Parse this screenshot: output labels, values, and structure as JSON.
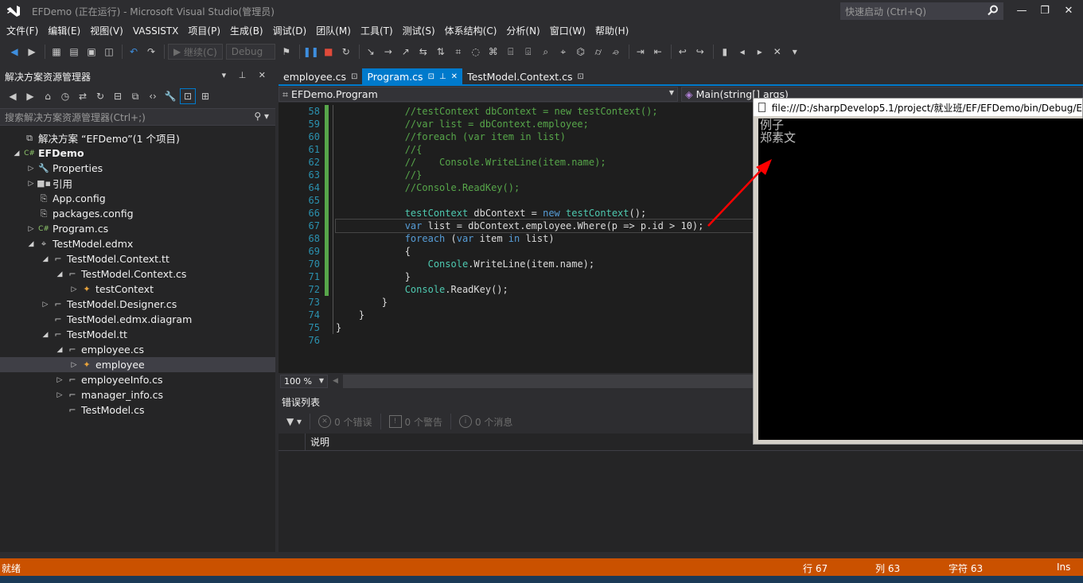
{
  "window": {
    "title": "EFDemo (正在运行) - Microsoft Visual Studio(管理员)",
    "quick_launch_placeholder": "快速启动 (Ctrl+Q)"
  },
  "menu": [
    "文件(F)",
    "编辑(E)",
    "视图(V)",
    "VASSISTX",
    "项目(P)",
    "生成(B)",
    "调试(D)",
    "团队(M)",
    "工具(T)",
    "测试(S)",
    "体系结构(C)",
    "分析(N)",
    "窗口(W)",
    "帮助(H)"
  ],
  "toolbar": {
    "continue_label": "继续(C)",
    "config_value": "Debug"
  },
  "solution_explorer": {
    "title": "解决方案资源管理器",
    "search_placeholder": "搜索解决方案资源管理器(Ctrl+;)",
    "tree": [
      {
        "label": "解决方案 “EFDemo”(1 个项目)",
        "indent": 0,
        "arrow": "",
        "icon": "solution-icon"
      },
      {
        "label": "EFDemo",
        "indent": 0,
        "arrow": "◢",
        "icon": "csharp-project-icon",
        "bold": true
      },
      {
        "label": "Properties",
        "indent": 1,
        "arrow": "▷",
        "icon": "wrench-icon"
      },
      {
        "label": "引用",
        "indent": 1,
        "arrow": "▷",
        "icon": "references-icon"
      },
      {
        "label": "App.config",
        "indent": 1,
        "arrow": "",
        "icon": "config-file-icon"
      },
      {
        "label": "packages.config",
        "indent": 1,
        "arrow": "",
        "icon": "config-file-icon"
      },
      {
        "label": "Program.cs",
        "indent": 1,
        "arrow": "▷",
        "icon": "csharp-file-icon"
      },
      {
        "label": "TestModel.edmx",
        "indent": 1,
        "arrow": "◢",
        "icon": "edmx-icon"
      },
      {
        "label": "TestModel.Context.tt",
        "indent": 2,
        "arrow": "◢",
        "icon": "tt-file-icon"
      },
      {
        "label": "TestModel.Context.cs",
        "indent": 3,
        "arrow": "◢",
        "icon": "cs-file-icon"
      },
      {
        "label": "testContext",
        "indent": 4,
        "arrow": "▷",
        "icon": "class-icon"
      },
      {
        "label": "TestModel.Designer.cs",
        "indent": 2,
        "arrow": "▷",
        "icon": "cs-file-icon"
      },
      {
        "label": "TestModel.edmx.diagram",
        "indent": 2,
        "arrow": "",
        "icon": "file-icon"
      },
      {
        "label": "TestModel.tt",
        "indent": 2,
        "arrow": "◢",
        "icon": "tt-file-icon"
      },
      {
        "label": "employee.cs",
        "indent": 3,
        "arrow": "◢",
        "icon": "cs-file-icon"
      },
      {
        "label": "employee",
        "indent": 4,
        "arrow": "▷",
        "icon": "class-icon",
        "selected": true
      },
      {
        "label": "employeeInfo.cs",
        "indent": 3,
        "arrow": "▷",
        "icon": "cs-file-icon"
      },
      {
        "label": "manager_info.cs",
        "indent": 3,
        "arrow": "▷",
        "icon": "cs-file-icon"
      },
      {
        "label": "TestModel.cs",
        "indent": 3,
        "arrow": "",
        "icon": "cs-file-icon"
      }
    ]
  },
  "tabs": [
    {
      "label": "employee.cs",
      "active": false
    },
    {
      "label": "Program.cs",
      "active": true
    },
    {
      "label": "TestModel.Context.cs",
      "active": false
    }
  ],
  "navbar": {
    "type_scope": "EFDemo.Program",
    "member_scope": "Main(string[] args)"
  },
  "editor": {
    "lines": [
      {
        "n": "58",
        "segs": [
          [
            "c-com",
            "            //testContext dbContext = new testContext();"
          ]
        ]
      },
      {
        "n": "59",
        "segs": [
          [
            "c-com",
            "            //var list = dbContext.employee;"
          ]
        ]
      },
      {
        "n": "60",
        "segs": [
          [
            "c-com",
            "            //foreach (var item in list)"
          ]
        ]
      },
      {
        "n": "61",
        "segs": [
          [
            "c-com",
            "            //{"
          ]
        ]
      },
      {
        "n": "62",
        "segs": [
          [
            "c-com",
            "            //    Console.WriteLine(item.name);"
          ]
        ]
      },
      {
        "n": "63",
        "segs": [
          [
            "c-com",
            "            //}"
          ]
        ]
      },
      {
        "n": "64",
        "segs": [
          [
            "c-com",
            "            //Console.ReadKey();"
          ]
        ]
      },
      {
        "n": "65",
        "segs": [
          [
            "",
            ""
          ]
        ]
      },
      {
        "n": "66",
        "segs": [
          [
            "c-ty",
            "            testContext"
          ],
          [
            "",
            " dbContext = "
          ],
          [
            "c-kw",
            "new"
          ],
          [
            "",
            " "
          ],
          [
            "c-ty",
            "testContext"
          ],
          [
            "",
            "();"
          ]
        ]
      },
      {
        "n": "67",
        "segs": [
          [
            "c-kw",
            "            var"
          ],
          [
            "",
            " list = dbContext.employee.Where(p => p.id > 10);"
          ]
        ],
        "current": true
      },
      {
        "n": "68",
        "segs": [
          [
            "c-kw",
            "            foreach"
          ],
          [
            "",
            " ("
          ],
          [
            "c-kw",
            "var"
          ],
          [
            "",
            " item "
          ],
          [
            "c-kw",
            "in"
          ],
          [
            "",
            " list)"
          ]
        ]
      },
      {
        "n": "69",
        "segs": [
          [
            "",
            "            {"
          ]
        ]
      },
      {
        "n": "70",
        "segs": [
          [
            "c-ty",
            "                Console"
          ],
          [
            "",
            ".WriteLine(item.name);"
          ]
        ]
      },
      {
        "n": "71",
        "segs": [
          [
            "",
            "            }"
          ]
        ]
      },
      {
        "n": "72",
        "segs": [
          [
            "c-ty",
            "            Console"
          ],
          [
            "",
            ".ReadKey();"
          ]
        ]
      },
      {
        "n": "73",
        "segs": [
          [
            "",
            "        }"
          ]
        ]
      },
      {
        "n": "74",
        "segs": [
          [
            "",
            "    }"
          ]
        ]
      },
      {
        "n": "75",
        "segs": [
          [
            "",
            "}"
          ]
        ]
      },
      {
        "n": "76",
        "segs": [
          [
            "",
            ""
          ]
        ]
      }
    ]
  },
  "zoom": "100 %",
  "error_list": {
    "title": "错误列表",
    "errors": "0 个错误",
    "warnings": "0 个警告",
    "messages": "0 个消息",
    "column_description": "说明"
  },
  "console": {
    "title": "file:///D:/sharpDevelop5.1/project/就业班/EF/EFDemo/bin/Debug/E",
    "lines": [
      "例子",
      "郑素文"
    ]
  },
  "status": {
    "state": "就绪",
    "line": "行 67",
    "col": "列 63",
    "char": "字符 63",
    "mode": "Ins"
  },
  "colors": {
    "accent": "#007acc",
    "statusbar_debug": "#ca5100",
    "annotation_arrow": "#ff0000"
  }
}
